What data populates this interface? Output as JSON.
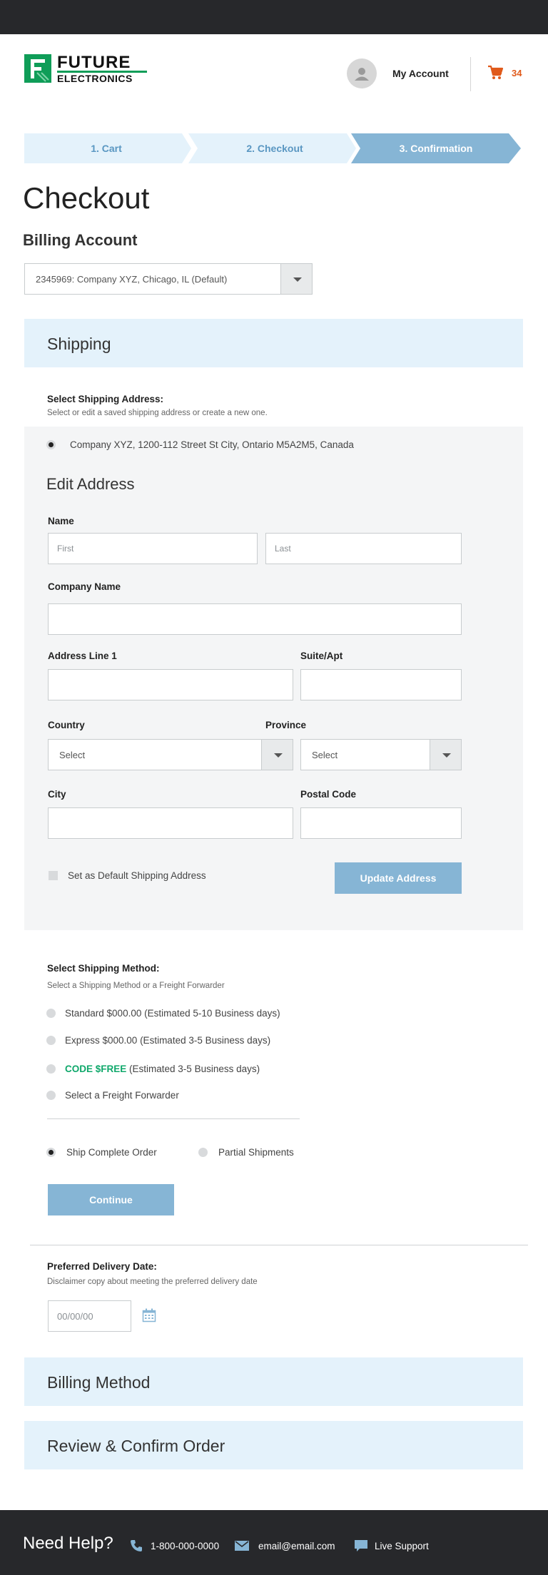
{
  "header": {
    "logo_line1": "FUTURE",
    "logo_line2": "ELECTRONICS",
    "account_label": "My Account",
    "cart_count": "34"
  },
  "steps": [
    {
      "label": "1. Cart",
      "active": false
    },
    {
      "label": "2. Checkout",
      "active": false
    },
    {
      "label": "3. Confirmation",
      "active": true
    }
  ],
  "page_title": "Checkout",
  "billing_account": {
    "heading": "Billing Account",
    "selected": "2345969: Company XYZ, Chicago, IL (Default)"
  },
  "shipping": {
    "title": "Shipping",
    "select_address_label": "Select Shipping Address:",
    "select_address_sub": "Select or edit a saved shipping address or create a new one.",
    "saved_address": "Company XYZ, 1200-112 Street St City, Ontario M5A2M5, Canada",
    "edit_heading": "Edit Address",
    "fields": {
      "name_label": "Name",
      "first_placeholder": "First",
      "last_placeholder": "Last",
      "company_label": "Company Name",
      "address1_label": "Address Line 1",
      "suite_label": "Suite/Apt",
      "country_label": "Country",
      "country_value": "Select",
      "province_label": "Province",
      "province_value": "Select",
      "city_label": "City",
      "postal_label": "Postal Code"
    },
    "default_checkbox_label": "Set as Default Shipping Address",
    "update_button": "Update Address",
    "method_label": "Select Shipping Method:",
    "method_sub": "Select a Shipping Method or a Freight Forwarder",
    "methods": [
      {
        "text": "Standard $000.00 (Estimated 5-10 Business days)"
      },
      {
        "text": "Express $000.00 (Estimated 3-5 Business days)"
      },
      {
        "code": "CODE $FREE",
        "text": " (Estimated 3-5 Business days)"
      },
      {
        "text": "Select a Freight Forwarder"
      }
    ],
    "ship_complete": "Ship Complete Order",
    "partial": "Partial Shipments",
    "continue_button": "Continue",
    "delivery_label": "Preferred Delivery Date:",
    "delivery_sub": "Disclaimer copy about meeting the preferred delivery date",
    "date_placeholder": "00/00/00"
  },
  "billing_method_title": "Billing Method",
  "review_title": "Review & Confirm Order",
  "footer": {
    "title": "Need Help?",
    "phone": "1-800-000-0000",
    "email": "email@email.com",
    "live_support": "Live Support"
  },
  "colors": {
    "accent": "#86b5d5",
    "panel": "#e4f2fb",
    "cart_orange": "#e05a1b",
    "brand_green": "#0f9d58",
    "dark_bar": "#27282b"
  }
}
